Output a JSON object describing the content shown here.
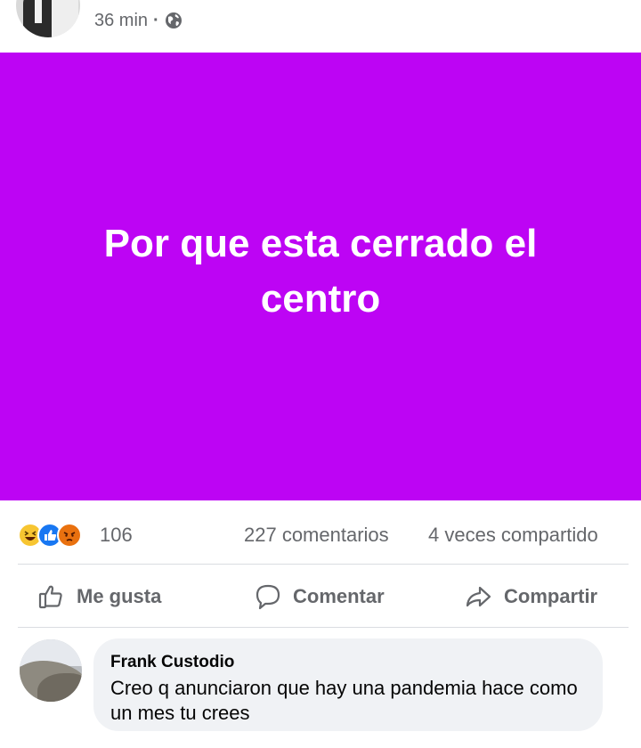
{
  "post": {
    "timestamp": "36 min",
    "separator": "·",
    "privacy_icon": "globe-icon",
    "text": "Por que esta cerrado el centro",
    "background_color": "#bd04f4"
  },
  "stats": {
    "reaction_icons": [
      "haha-icon",
      "like-icon",
      "angry-icon"
    ],
    "reaction_count": "106",
    "comments": "227 comentarios",
    "shares": "4 veces compartido"
  },
  "actions": {
    "like_label": "Me gusta",
    "comment_label": "Comentar",
    "share_label": "Compartir"
  },
  "comment": {
    "author": "Frank Custodio",
    "text": "Creo q anunciaron que hay una pandemia hace como un mes tu crees"
  }
}
